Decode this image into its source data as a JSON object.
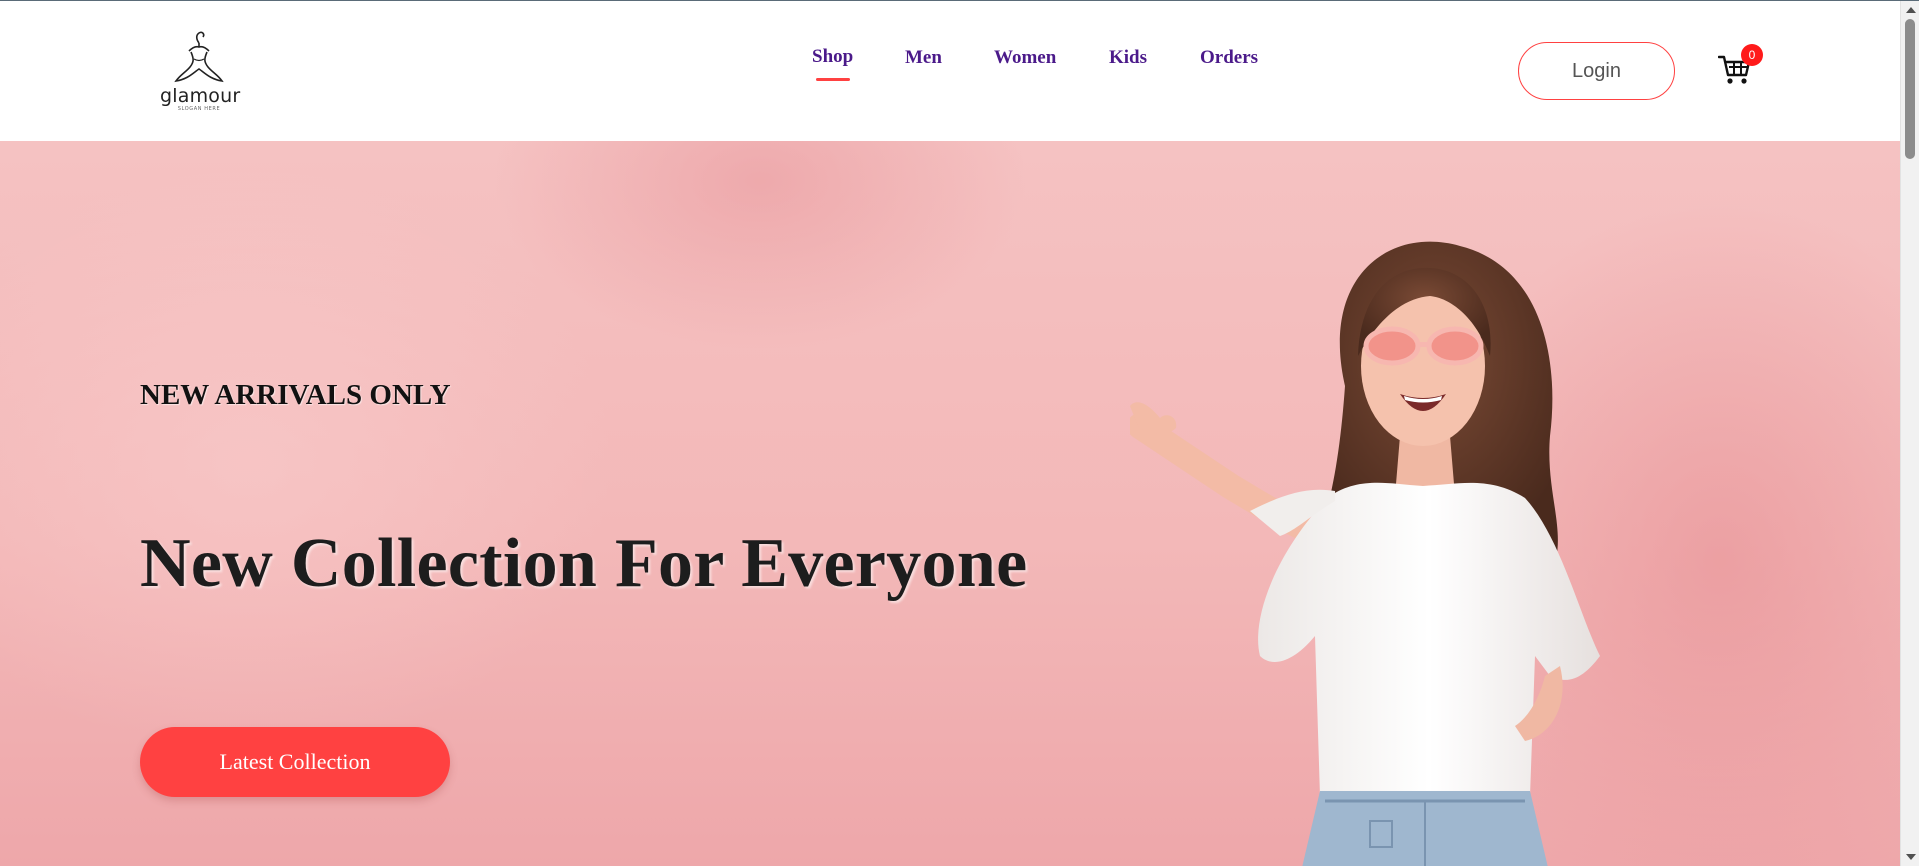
{
  "header": {
    "logo": {
      "name": "glamour",
      "slogan": "SLOGAN HERE",
      "icon": "dress-hanger-icon"
    },
    "nav": [
      {
        "label": "Shop",
        "active": true
      },
      {
        "label": "Men",
        "active": false
      },
      {
        "label": "Women",
        "active": false
      },
      {
        "label": "Kids",
        "active": false
      },
      {
        "label": "Orders",
        "active": false
      }
    ],
    "login_label": "Login",
    "cart": {
      "icon": "cart-icon",
      "count": "0"
    }
  },
  "hero": {
    "subtitle": "NEW ARRIVALS ONLY",
    "title": "New Collection For Everyone",
    "button_label": "Latest Collection",
    "image": "smiling-woman-pink-sunglasses"
  },
  "colors": {
    "accent": "#ff4141",
    "nav_text": "#4b1a8a",
    "hero_background": "#f4bfbf"
  }
}
